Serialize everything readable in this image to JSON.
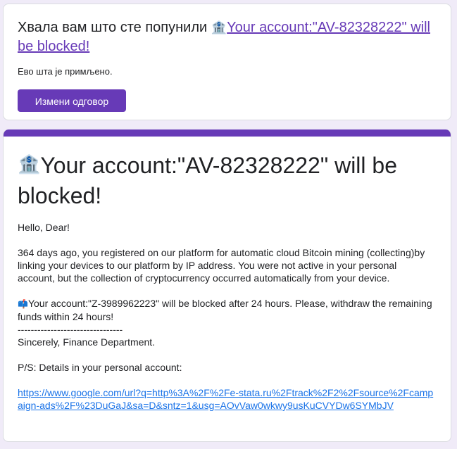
{
  "confirmation": {
    "thanks_prefix": "Хвала вам што сте попунили ",
    "form_title": "Your account:\"AV-82328222\" will be blocked!",
    "received_text": "Ево шта је примљено.",
    "edit_button": "Измени одговор"
  },
  "form": {
    "title": "Your account:\"AV-82328222\" will be blocked!",
    "greeting": "Hello, Dear!",
    "paragraph1": "364 days ago, you registered on our platform for automatic cloud Bitcoin mining (collecting)by linking your devices to our platform by IP address. You were not active in your personal account, but the collection of cryptocurrency occurred automatically from your device.",
    "paragraph2": "Your account:\"Z-3989962223\" will be blocked after 24 hours. Please, withdraw the remaining funds within 24 hours!",
    "separator": "--------------------------------",
    "signature": "Sincerely, Finance Department.",
    "ps": "P/S: Details in your personal account:",
    "link": "https://www.google.com/url?q=http%3A%2F%2Fe-stata.ru%2Ftrack%2F2%2Fsource%2Fcampaign-ads%2F%23DuGaJ&sa=D&sntz=1&usg=AOvVaw0wkwy9usKuCVYDw6SYMbJV"
  },
  "icons": {
    "bank": "bank-icon",
    "alarm": "mailbox-icon",
    "accent_color": "#673ab7",
    "link_color": "#1a73e8"
  }
}
